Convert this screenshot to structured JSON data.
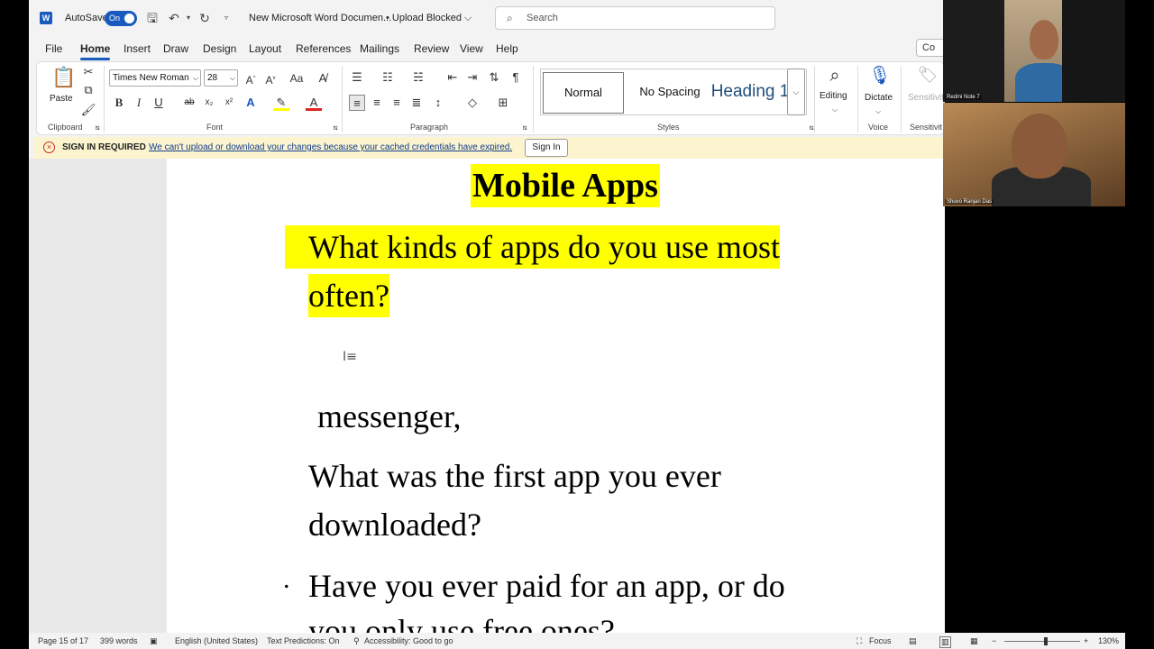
{
  "titlebar": {
    "autosave_label": "AutoSave",
    "autosave_state": "On",
    "document_title": "New Microsoft Word Documen...",
    "upload_status": "• Upload Blocked",
    "search_placeholder": "Search"
  },
  "menu": {
    "tabs": [
      "File",
      "Home",
      "Insert",
      "Draw",
      "Design",
      "Layout",
      "References",
      "Mailings",
      "Review",
      "View",
      "Help"
    ],
    "active_tab": "Home",
    "comments_label": "Co"
  },
  "ribbon": {
    "clipboard": {
      "paste_label": "Paste",
      "group_label": "Clipboard"
    },
    "font": {
      "font_name": "Times New Roman",
      "font_size": "28",
      "group_label": "Font"
    },
    "paragraph": {
      "group_label": "Paragraph"
    },
    "styles": {
      "items": [
        "Normal",
        "No Spacing",
        "Heading 1"
      ],
      "group_label": "Styles"
    },
    "editing": {
      "label": "Editing"
    },
    "voice": {
      "dictate_label": "Dictate",
      "group_label": "Voice"
    },
    "sensitivity": {
      "label": "Sensitivity",
      "group_label": "Sensitivit"
    }
  },
  "infobar": {
    "title": "SIGN IN REQUIRED",
    "message": "We can't upload or download your changes because your cached credentials have expired.",
    "button_label": "Sign In"
  },
  "document": {
    "heading": "Mobile Apps",
    "q1_line1": "What kinds of apps do you use most",
    "q1_line2": "often?",
    "answer": "messenger,",
    "q2_line1": "What was the first app you ever",
    "q2_line2": "downloaded?",
    "q3_line1": "Have you ever paid for an app, or do",
    "q3_line2": "you only use free ones?"
  },
  "statusbar": {
    "page": "Page 15 of 17",
    "words": "399 words",
    "language": "English (United States)",
    "predictions": "Text Predictions: On",
    "accessibility": "Accessibility: Good to go",
    "focus": "Focus",
    "zoom": "130%"
  },
  "video": {
    "tile1_name": "Redmi Note 7",
    "tile2_name": "Shuvo Ranjan Das"
  },
  "colors": {
    "accent": "#185abd",
    "highlight": "#ffff00",
    "infobar_bg": "#fcf4cf",
    "error": "#c42b1c"
  }
}
